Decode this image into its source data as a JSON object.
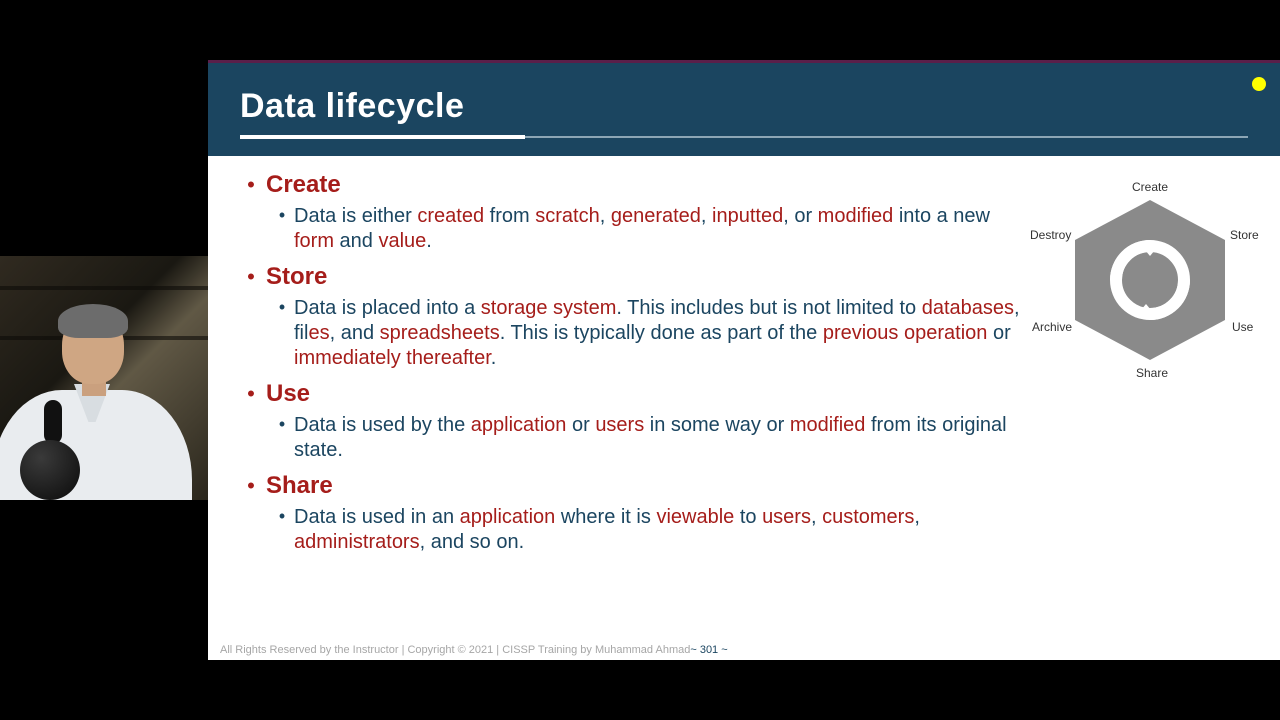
{
  "header": {
    "title": "Data lifecycle"
  },
  "sections": [
    {
      "title": "Create",
      "body": {
        "p0": "Data is either ",
        "k0": "created",
        "p1": " from ",
        "k1": "scratch",
        "p2": ", ",
        "k2": "generated",
        "p3": ", ",
        "k3": "inputted",
        "p4": ", or ",
        "k4": "modified",
        "p5": " into a new ",
        "k5": "form",
        "p6": " and ",
        "k6": "value",
        "p7": "."
      }
    },
    {
      "title": "Store",
      "body": {
        "p0": "Data is placed into a ",
        "k0": "storage system",
        "p1": ". This includes but is not limited to ",
        "k1": "databases",
        "p2": ", fil",
        "k2": "es",
        "p3": ", and ",
        "k3": "spreadsheets",
        "p4": ". This is typically done as part of the ",
        "k4": "previous operation",
        "p5": " or ",
        "k5": "immediately thereafter",
        "p6": "."
      }
    },
    {
      "title": "Use",
      "body": {
        "p0": "Data is used by the ",
        "k0": "application",
        "p1": " or ",
        "k1": "users",
        "p2": " in some way or ",
        "k2": "modified",
        "p3": " from its original state."
      }
    },
    {
      "title": "Share",
      "body": {
        "p0": "Data is used in an ",
        "k0": "application",
        "p1": " where it is ",
        "k1": "viewable",
        "p2": " to ",
        "k2": "users",
        "p3": ", ",
        "k3": "customers",
        "p4": ", ",
        "k4": "administrators",
        "p5": ", and so on."
      }
    }
  ],
  "diagram": {
    "labels": [
      "Create",
      "Store",
      "Use",
      "Share",
      "Archive",
      "Destroy"
    ]
  },
  "footer": {
    "text": "All Rights Reserved by the Instructor | Copyright © 2021 | CISSP Training by Muhammad Ahmad",
    "page": "~ 301 ~"
  }
}
